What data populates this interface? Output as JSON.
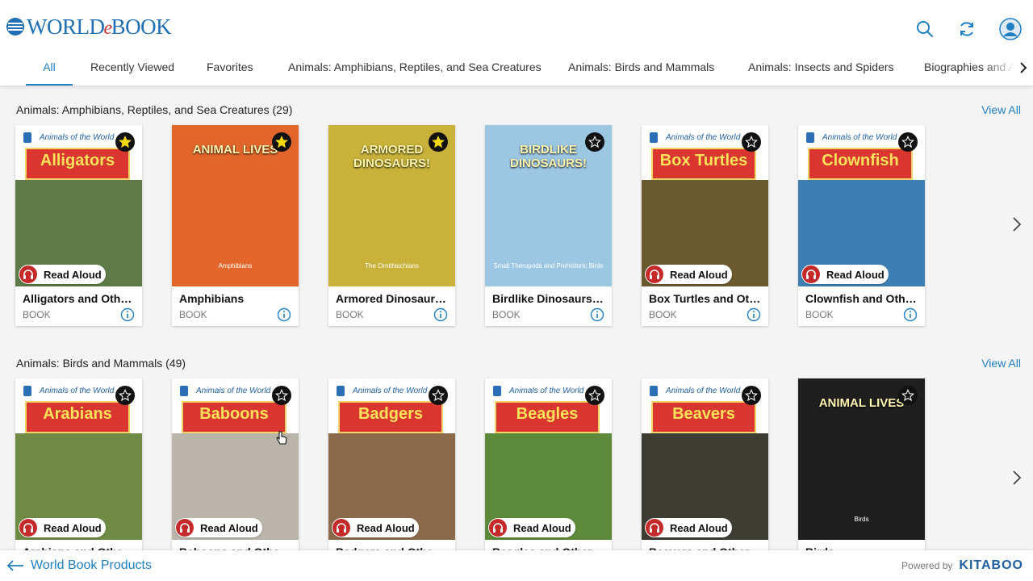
{
  "app": {
    "logo": {
      "part1": "WORLD",
      "part2": "e",
      "part3": "BOOK"
    }
  },
  "header": {
    "icons": [
      "search-icon",
      "refresh-icon",
      "user-avatar-icon"
    ]
  },
  "tabs": [
    {
      "label": "All",
      "active": true
    },
    {
      "label": "Recently Viewed"
    },
    {
      "label": "Favorites"
    },
    {
      "label": "Animals: Amphibians, Reptiles, and Sea Creatures"
    },
    {
      "label": "Animals: Birds and Mammals"
    },
    {
      "label": "Animals: Insects and Spiders"
    },
    {
      "label": "Biographies and Autobiographies"
    }
  ],
  "sections": [
    {
      "title": "Animals: Amphibians, Reptiles, and Sea Creatures (29)",
      "view_all": "View All",
      "books": [
        {
          "title": "Alligators and Other Crocodilians",
          "type": "BOOK",
          "favorite": true,
          "read_aloud": "Read Aloud",
          "series": "Animals of the World",
          "cover_title": "Alligators",
          "cover_color": "#5e7a49"
        },
        {
          "title": "Amphibians",
          "type": "BOOK",
          "favorite": true,
          "cover_title": "ANIMAL LIVES",
          "series": "Amphibians",
          "cover_color": "#e2662c"
        },
        {
          "title": "Armored Dinosaurs: The Ornithischians",
          "type": "BOOK",
          "favorite": true,
          "cover_title": "ARMORED DINOSAURS!",
          "series": "The Ornithischians",
          "cover_color": "#c8b23a"
        },
        {
          "title": "Birdlike Dinosaurs: Small Theropods and Prehistoric Birds",
          "type": "BOOK",
          "favorite": false,
          "cover_title": "BIRDLIKE DINOSAURS!",
          "series": "Small Theropods and Prehistoric Birds",
          "cover_color": "#9cc7e3"
        },
        {
          "title": "Box Turtles and Other Tortoises",
          "type": "BOOK",
          "favorite": false,
          "read_aloud": "Read Aloud",
          "series": "Animals of the World",
          "cover_title": "Box Turtles",
          "cover_color": "#6b5a2e"
        },
        {
          "title": "Clownfish and Other Coral Reef Fish",
          "type": "BOOK",
          "favorite": false,
          "read_aloud": "Read Aloud",
          "series": "Animals of the World",
          "cover_title": "Clownfish",
          "cover_color": "#3e7fb3"
        }
      ]
    },
    {
      "title": "Animals: Birds and Mammals (49)",
      "view_all": "View All",
      "books": [
        {
          "title": "Arabians and Other Horses",
          "type": "BOOK",
          "favorite": false,
          "read_aloud": "Read Aloud",
          "series": "Animals of the World",
          "cover_title": "Arabians",
          "cover_color": "#6f8a45"
        },
        {
          "title": "Baboons and Other Monkeys",
          "type": "BOOK",
          "favorite": false,
          "read_aloud": "Read Aloud",
          "series": "Animals of the World",
          "cover_title": "Baboons",
          "cover_color": "#b9b5ab"
        },
        {
          "title": "Badgers and Other Mustelids",
          "type": "BOOK",
          "favorite": false,
          "read_aloud": "Read Aloud",
          "series": "Animals of the World",
          "cover_title": "Badgers",
          "cover_color": "#8a6a4a"
        },
        {
          "title": "Beagles and Other Hounds",
          "type": "BOOK",
          "favorite": false,
          "read_aloud": "Read Aloud",
          "series": "Animals of the World",
          "cover_title": "Beagles",
          "cover_color": "#5c8a3a"
        },
        {
          "title": "Beavers and Other Rodents",
          "type": "BOOK",
          "favorite": false,
          "read_aloud": "Read Aloud",
          "series": "Animals of the World",
          "cover_title": "Beavers",
          "cover_color": "#3d3d33"
        },
        {
          "title": "Birds",
          "type": "BOOK",
          "favorite": false,
          "cover_title": "ANIMAL LIVES",
          "series": "Birds",
          "cover_color": "#1f1f1f"
        }
      ]
    }
  ],
  "footer": {
    "back_label": "World Book Products",
    "powered_by": "Powered by",
    "brand": "KITABOO"
  }
}
